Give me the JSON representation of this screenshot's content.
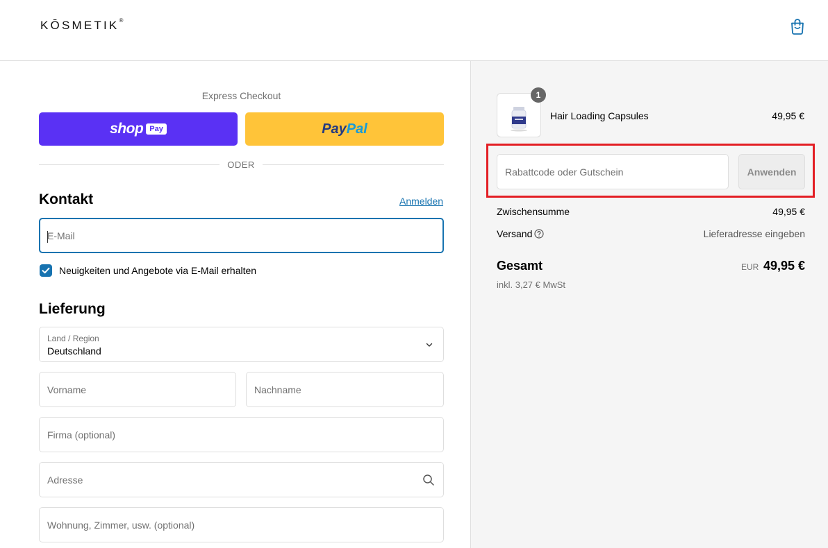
{
  "header": {
    "logo": "KŌSMETIK",
    "logo_mark": "®"
  },
  "express": {
    "label": "Express Checkout",
    "shop_pay": {
      "word": "shop",
      "badge": "Pay"
    },
    "paypal": {
      "word1": "Pay",
      "word2": "Pal"
    },
    "divider": "ODER"
  },
  "contact": {
    "heading": "Kontakt",
    "login_link": "Anmelden",
    "email_placeholder": "E-Mail",
    "newsletter_label": "Neuigkeiten und Angebote via E-Mail erhalten",
    "newsletter_checked": true
  },
  "delivery": {
    "heading": "Lieferung",
    "country_label": "Land / Region",
    "country_value": "Deutschland",
    "first_name_placeholder": "Vorname",
    "last_name_placeholder": "Nachname",
    "company_placeholder": "Firma (optional)",
    "address_placeholder": "Adresse",
    "apartment_placeholder": "Wohnung, Zimmer, usw. (optional)"
  },
  "summary": {
    "product": {
      "name": "Hair Loading Capsules",
      "price": "49,95 €",
      "quantity": "1"
    },
    "discount_placeholder": "Rabattcode oder Gutschein",
    "apply_label": "Anwenden",
    "subtotal_label": "Zwischensumme",
    "subtotal_value": "49,95 €",
    "shipping_label": "Versand",
    "shipping_value": "Lieferadresse eingeben",
    "total_label": "Gesamt",
    "total_currency": "EUR",
    "total_value": "49,95 €",
    "tax_note": "inkl. 3,27 € MwSt"
  },
  "colors": {
    "accent": "#1773b0",
    "shop_pay": "#5a31f4",
    "paypal": "#ffc439",
    "highlight": "#e31e24"
  }
}
